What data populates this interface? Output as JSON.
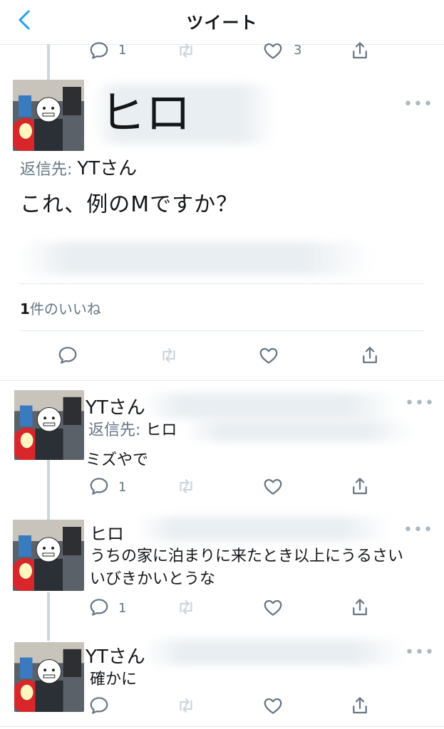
{
  "header": {
    "title": "ツイート",
    "back_icon": "chevron-left-icon"
  },
  "colors": {
    "accent": "#1da1f2",
    "icon_gray": "#657786",
    "thread_line": "#ccd6dd"
  },
  "top_actions": {
    "reply_count": "1",
    "like_count": "3"
  },
  "main_tweet": {
    "display_name": "ヒロ",
    "reply_to_label": "返信先:",
    "reply_to_user": "YTさん",
    "text": "これ、例のMですか？",
    "likes_count": "1",
    "likes_suffix": "件のいいね"
  },
  "replies": [
    {
      "display_name": "YTさん",
      "reply_to_label": "返信先:",
      "reply_to_user": "ヒロ",
      "text": "ミズやで",
      "reply_count": "1"
    },
    {
      "display_name": "ヒロ",
      "text": "うちの家に泊まりに来たとき以上にうるさいいびきかいとうな",
      "text_line1": "うちの家に泊まりに来たとき以上にうるさい",
      "text_line2": "いびきかいとうな",
      "reply_count": "1"
    },
    {
      "display_name": "YTさん",
      "text": "確かに"
    }
  ]
}
